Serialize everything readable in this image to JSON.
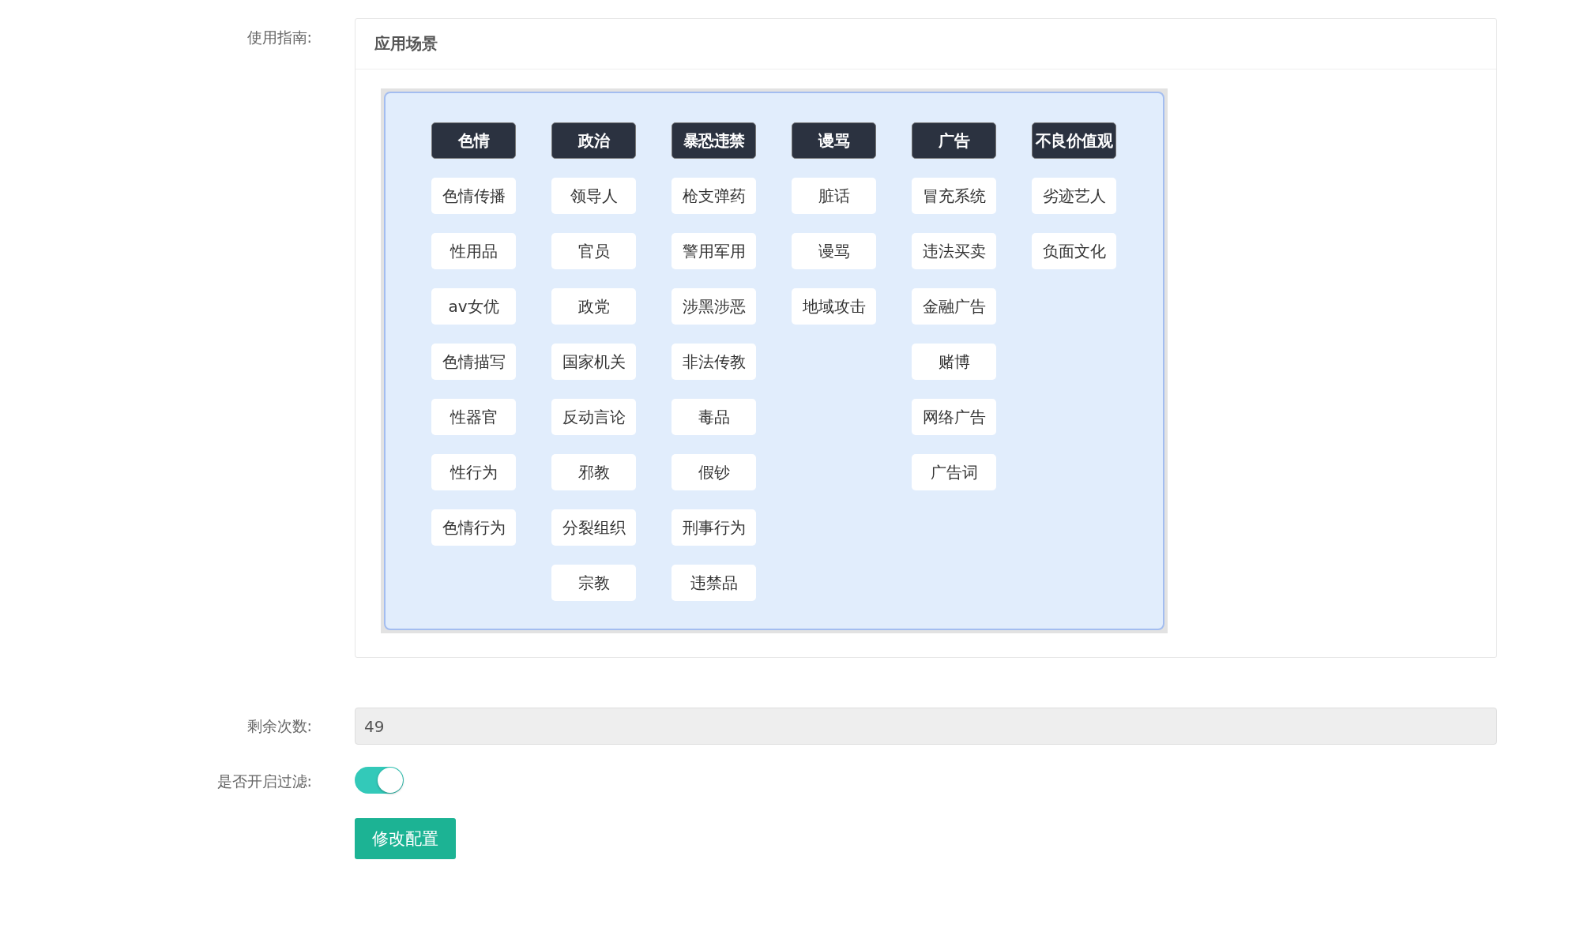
{
  "guide": {
    "label": "使用指南:",
    "panel_title": "应用场景",
    "columns": [
      {
        "header": "色情",
        "items": [
          "色情传播",
          "性用品",
          "av女优",
          "色情描写",
          "性器官",
          "性行为",
          "色情行为"
        ]
      },
      {
        "header": "政治",
        "items": [
          "领导人",
          "官员",
          "政党",
          "国家机关",
          "反动言论",
          "邪教",
          "分裂组织",
          "宗教"
        ]
      },
      {
        "header": "暴恐违禁",
        "items": [
          "枪支弹药",
          "警用军用",
          "涉黑涉恶",
          "非法传教",
          "毒品",
          "假钞",
          "刑事行为",
          "违禁品"
        ]
      },
      {
        "header": "谩骂",
        "items": [
          "脏话",
          "谩骂",
          "地域攻击"
        ]
      },
      {
        "header": "广告",
        "items": [
          "冒充系统",
          "违法买卖",
          "金融广告",
          "赌博",
          "网络广告",
          "广告词"
        ]
      },
      {
        "header": "不良价值观",
        "items": [
          "劣迹艺人",
          "负面文化"
        ]
      }
    ]
  },
  "remaining": {
    "label": "剩余次数:",
    "value": "49"
  },
  "filter": {
    "label": "是否开启过滤:",
    "on": true
  },
  "submit": {
    "label": "修改配置"
  }
}
